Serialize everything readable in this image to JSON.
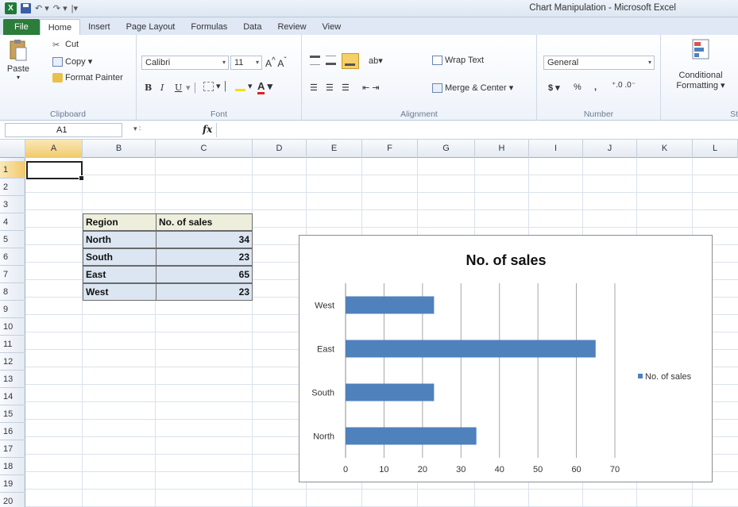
{
  "window": {
    "title": "Chart Manipulation - Microsoft Excel"
  },
  "tabs": [
    "File",
    "Home",
    "Insert",
    "Page Layout",
    "Formulas",
    "Data",
    "Review",
    "View"
  ],
  "ribbon": {
    "clipboard": {
      "paste": "Paste",
      "cut": "Cut",
      "copy": "Copy",
      "format_painter": "Format Painter",
      "label": "Clipboard"
    },
    "font": {
      "name": "Calibri",
      "size": "11",
      "bold": "B",
      "italic": "I",
      "underline": "U",
      "label": "Font"
    },
    "alignment": {
      "wrap_text": "Wrap Text",
      "merge_center": "Merge & Center",
      "label": "Alignment"
    },
    "number": {
      "format": "General",
      "currency": "$",
      "percent": "%",
      "comma": ",",
      "label": "Number"
    },
    "styles": {
      "conditional": "Conditional",
      "formatting": "Formatting",
      "label": "St"
    }
  },
  "formula_bar": {
    "name_box": "A1",
    "fx": "fx",
    "content": ""
  },
  "grid": {
    "columns": [
      "A",
      "B",
      "C",
      "D",
      "E",
      "F",
      "G",
      "H",
      "I",
      "J",
      "K",
      "L"
    ],
    "selected_column": "A",
    "rows": [
      "1",
      "2",
      "3",
      "4",
      "5",
      "6",
      "7",
      "8",
      "9",
      "10",
      "11",
      "12",
      "13",
      "14",
      "15",
      "16",
      "17",
      "18",
      "19",
      "20"
    ],
    "selected_row": "1"
  },
  "table": {
    "headers": [
      "Region",
      "No. of sales"
    ],
    "rows": [
      {
        "region": "North",
        "sales": "34"
      },
      {
        "region": "South",
        "sales": "23"
      },
      {
        "region": "East",
        "sales": "65"
      },
      {
        "region": "West",
        "sales": "23"
      }
    ]
  },
  "chart_data": {
    "type": "bar",
    "orientation": "horizontal",
    "title": "No. of sales",
    "categories": [
      "North",
      "South",
      "East",
      "West"
    ],
    "series": [
      {
        "name": "No. of sales",
        "values": [
          34,
          23,
          65,
          23
        ],
        "color": "#4f81bd"
      }
    ],
    "xlim": [
      0,
      70
    ],
    "ticks": [
      "0",
      "10",
      "20",
      "30",
      "40",
      "50",
      "60",
      "70"
    ],
    "grid": true,
    "legend": "right"
  }
}
